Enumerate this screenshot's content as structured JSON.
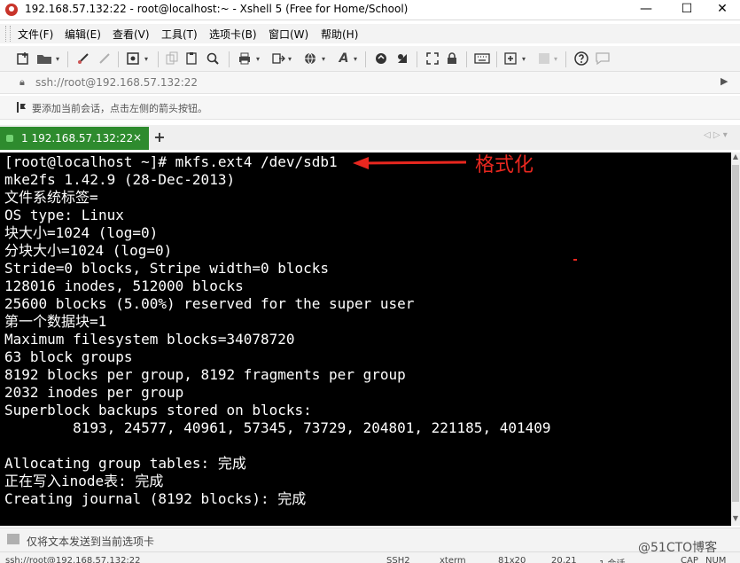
{
  "window": {
    "title": "192.168.57.132:22 - root@localhost:~ - Xshell 5 (Free for Home/School)",
    "minimize": "—",
    "maximize": "☐",
    "close": "✕"
  },
  "menu": [
    {
      "label": "文件(F)"
    },
    {
      "label": "编辑(E)"
    },
    {
      "label": "查看(V)"
    },
    {
      "label": "工具(T)"
    },
    {
      "label": "选项卡(B)"
    },
    {
      "label": "窗口(W)"
    },
    {
      "label": "帮助(H)"
    }
  ],
  "address": {
    "text": "ssh://root@192.168.57.132:22"
  },
  "hint": {
    "text": "要添加当前会话，点击左侧的箭头按钮。"
  },
  "tabs": [
    {
      "label": "1 192.168.57.132:22",
      "close": "×"
    }
  ],
  "terminal": {
    "lines": [
      "[root@localhost ~]# mkfs.ext4 /dev/sdb1",
      "mke2fs 1.42.9 (28-Dec-2013)",
      "文件系统标签=",
      "OS type: Linux",
      "块大小=1024 (log=0)",
      "分块大小=1024 (log=0)",
      "Stride=0 blocks, Stripe width=0 blocks",
      "128016 inodes, 512000 blocks",
      "25600 blocks (5.00%) reserved for the super user",
      "第一个数据块=1",
      "Maximum filesystem blocks=34078720",
      "63 block groups",
      "8192 blocks per group, 8192 fragments per group",
      "2032 inodes per group",
      "Superblock backups stored on blocks:",
      "        8193, 24577, 40961, 57345, 73729, 204801, 221185, 401409",
      "",
      "Allocating group tables: 完成",
      "正在写入inode表: 完成",
      "Creating journal (8192 blocks): 完成"
    ],
    "annotation": "格式化",
    "annotation_color": "#e8271f"
  },
  "compose": {
    "text": "仅将文本发送到当前选项卡"
  },
  "status": {
    "connection": "ssh://root@192.168.57.132:22",
    "protocol": "SSH2",
    "terminal": "xterm",
    "size": "81x20",
    "cursor": "20,21",
    "sessions": "1 会话",
    "caps": "CAP",
    "num": "NUM"
  },
  "watermark": "@51CTO博客"
}
